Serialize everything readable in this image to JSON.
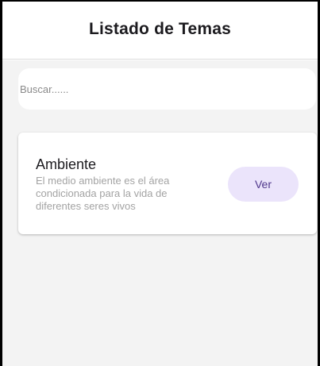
{
  "app_bar": {
    "title": "Listado de Temas"
  },
  "search": {
    "placeholder": "Buscar......",
    "value": ""
  },
  "topics": [
    {
      "title": "Ambiente",
      "description": "El medio ambiente es el área condicionada para la vida de diferentes seres vivos",
      "button_label": "Ver"
    }
  ],
  "colors": {
    "background": "#f3f3f3",
    "surface": "#ffffff",
    "button_bg": "#ebe4fb",
    "button_text": "#4f378b",
    "secondary_text": "#a3a3a3"
  }
}
